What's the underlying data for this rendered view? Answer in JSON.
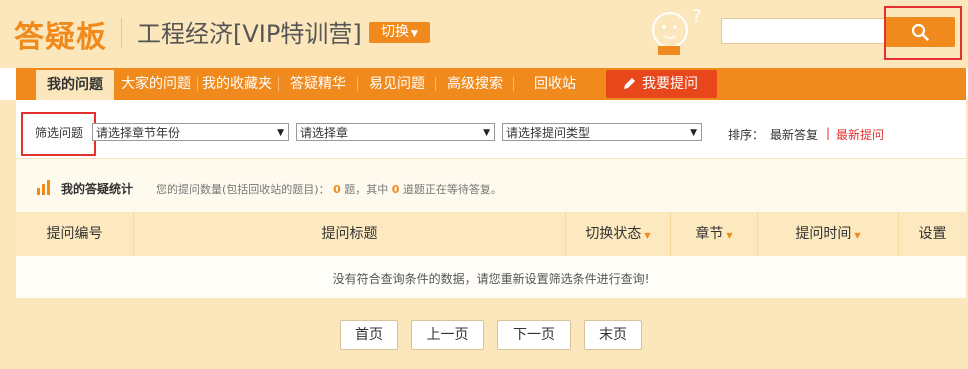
{
  "header": {
    "logo": "答疑板",
    "course": "工程经济[VIP特训营]",
    "switch_label": "切换",
    "search": {
      "value": "",
      "placeholder": ""
    }
  },
  "nav": {
    "tabs": [
      "我的问题",
      "大家的问题",
      "我的收藏夹",
      "答疑精华",
      "易见问题",
      "高级搜索",
      "回收站"
    ],
    "ask_label": "我要提问"
  },
  "filter": {
    "label": "筛选问题",
    "selects": [
      "请选择章节年份",
      "请选择章",
      "请选择提问类型"
    ],
    "sort_label": "排序：",
    "sort_options": [
      "最新答复",
      "|",
      "最新提问"
    ]
  },
  "stats": {
    "title": "我的答疑统计",
    "prefix": "您的提问数量(包括回收站的题目)：",
    "count": "0",
    "middle": "题，其中",
    "waiting": "0",
    "suffix": "道题正在等待答复。"
  },
  "table": {
    "columns": [
      "提问编号",
      "提问标题",
      "切换状态",
      "章节",
      "提问时间",
      "设置"
    ],
    "empty_message": "没有符合查询条件的数据，请您重新设置筛选条件进行查询!"
  },
  "pagination": [
    "首页",
    "上一页",
    "下一页",
    "末页"
  ],
  "colors": {
    "accent": "#f08a1d",
    "highlight": "#e53030",
    "background": "#fce7bc"
  }
}
